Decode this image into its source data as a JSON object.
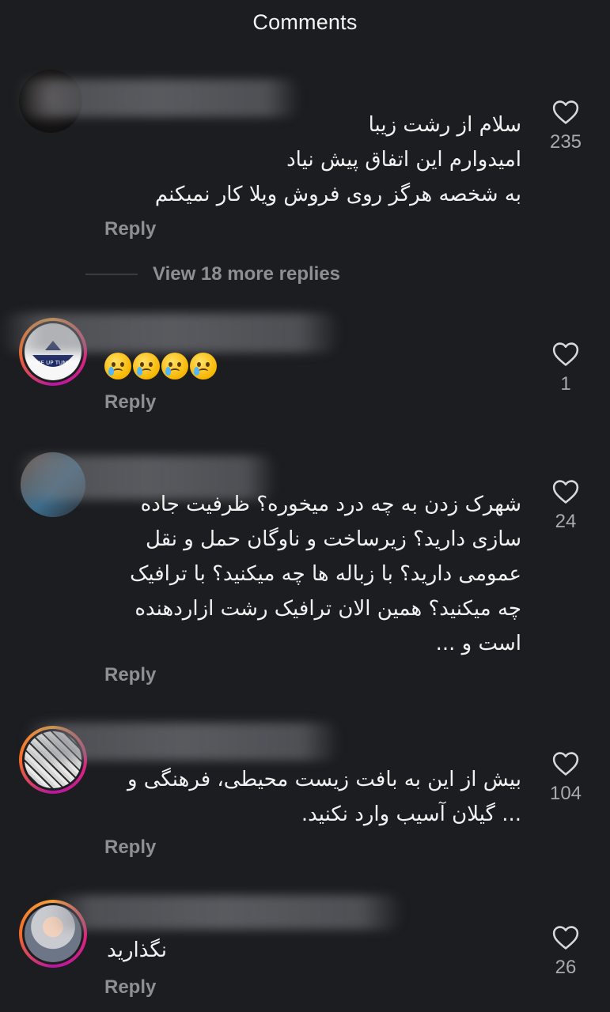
{
  "header": {
    "title": "Comments"
  },
  "icons": {
    "like": "heart-outline-icon"
  },
  "colors": {
    "background": "#1c1d20",
    "text": "#f2f2f2",
    "muted": "#8e8f93",
    "story_ring": "#e0267d"
  },
  "comments": [
    {
      "text": "سلام از رشت زیبا\nامیدوارم این اتفاق پیش نیاد\nبه شخصه هرگز روی فروش ویلا کار نمیکنم",
      "reply_label": "Reply",
      "likes": "235",
      "view_more": "View 18 more replies"
    },
    {
      "text": "",
      "emoji": [
        "crying-face",
        "crying-face",
        "crying-face",
        "crying-face"
      ],
      "avatar_text": "TUNE UP TUNING",
      "reply_label": "Reply",
      "likes": "1"
    },
    {
      "text": "شهرک زدن به چه درد میخوره؟ ظرفیت جاده\nسازی دارید؟ زیرساخت و ناوگان حمل و نقل\nعمومی دارید؟ با زباله ها چه میکنید؟ با ترافیک\nچه میکنید؟ همین الان ترافیک رشت ازاردهنده\nاست و ...",
      "reply_label": "Reply",
      "likes": "24"
    },
    {
      "text": "بیش از این به بافت زیست محیطی، فرهنگی و\n... گیلان آسیب وارد نکنید.",
      "reply_label": "Reply",
      "likes": "104"
    },
    {
      "text": "نگذارید",
      "reply_label": "Reply",
      "likes": "26"
    }
  ]
}
